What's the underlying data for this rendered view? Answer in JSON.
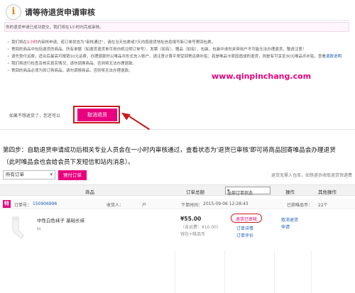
{
  "notice": {
    "title": "请等待退货申请审核",
    "status_text": "你的退货申请已成功提交，我们将在1小时内完成审核。",
    "notes": [
      {
        "pre": "我们将在",
        "hl": "1小时",
        "post": "内审核申请，若订单状态为\"审核通过\"，请在当天包裹或7天内按退货地址信息填写新订单号寄回包裹。"
      },
      {
        "pre": "寄回的商品中包括退货的商品、所有单据（如退货退货单可用白纸注明订单号）、发票（如有）、赠品（如有）、包装，包装中请勿夹带用户不可能无法办理退货，敬请注意！",
        "hl": "",
        "post": ""
      },
      {
        "pre": "请先垫付运费，适合后最高可报销10元运费，办理退款时以唯品币形式充入账户，请注意计算平常受回寄运费补贴；若是唯品卡原因造成的退货，则是有可享至30元唯品币补贴，查看",
        "hl": "",
        "post": "",
        "link": "退款说明"
      },
      {
        "pre": "我们将进行检查及核实真实情况，请勿调换商品，否则将无法办理退款。",
        "hl": "",
        "post": ""
      },
      {
        "pre": "寄回的商品必须为原订购商品，请勿调换商品，否则将无法办理退款。",
        "hl": "",
        "post": ""
      }
    ],
    "cancel_prompt": "如果不想退货了，您还可以",
    "cancel_button": "取消退货"
  },
  "step": {
    "line1": "第四步：自助退货申请成功后相关专业人员会在一小时内审核通过，查看状态为'退货已审核'即可将商品回寄唯品会办理退货",
    "line2": "（此时唯品会也会给会员下发短信和站内消息）。"
  },
  "orders": {
    "filter_value": "所有订单",
    "presale_button": "预付订单",
    "hint": "退货无需入仓库，如快递员收取退货快递费",
    "columns": {
      "product": "商品",
      "total": "订单总额",
      "status_select": "全部订单状态",
      "action": "操作",
      "other": "其他操作"
    },
    "order": {
      "vip_mark": "特",
      "order_label": "订单号：",
      "order_no": "150906996",
      "receiver_label": "收货人：",
      "receiver": "户",
      "time_label": "下单时间：",
      "time": "2015-09-06 12:28:43",
      "shipped_label": "已获唯品币：",
      "shipped_value": "22个"
    },
    "item": {
      "name": "中性白色袜子 基础长袜",
      "size": "M",
      "price": "¥55.00",
      "price_note": "（含运费：¥10.00）",
      "pay_method": "钱包+唯品币",
      "status": "退货已审核",
      "status_link1": "订单详情",
      "status_link2": "订单评价",
      "action1": "取消退货",
      "action2": "申请"
    }
  },
  "watermark": "www.qinpinchang.com",
  "colors": {
    "brand": "#e8007f",
    "highlight": "#c81a1a",
    "link": "#1a5bb5"
  }
}
